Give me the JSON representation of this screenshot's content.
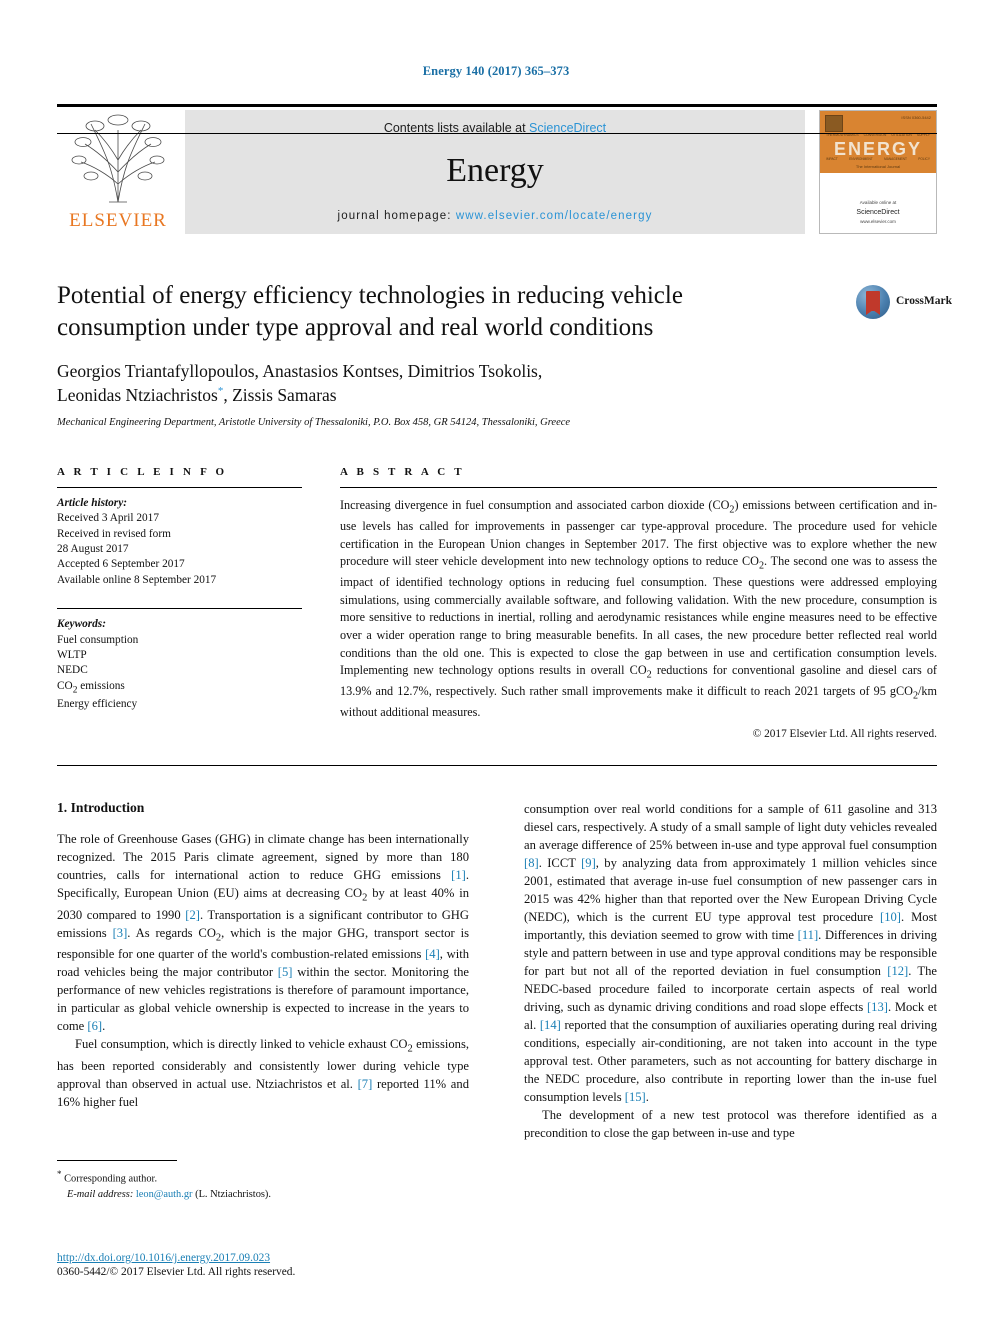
{
  "running_head": "Energy 140 (2017) 365–373",
  "masthead": {
    "contents_prefix": "Contents lists available at ",
    "contents_link": "ScienceDirect",
    "journal_name": "Energy",
    "homepage_prefix": "journal homepage: ",
    "homepage_url": "www.elsevier.com/locate/energy",
    "publisher_name": "ELSEVIER",
    "publisher_logo_alt": "elsevier-tree-logo"
  },
  "cover": {
    "title": "ENERGY",
    "subtitle": "The International Journal",
    "top_right": "ISSN 0360-5442",
    "topics_row1": [
      "THERMODYNAMICS",
      "CONVERSION",
      "UTILIZATION",
      "SUPPLY"
    ],
    "topics_row2": [
      "IMPACT",
      "ENVIRONMENT",
      "MANAGEMENT",
      "POLICY"
    ],
    "footer_small": "Available online at",
    "footer_big": "ScienceDirect",
    "footer_sub": "www.elsevier.com"
  },
  "crossmark": {
    "label": "CrossMark",
    "badge_alt": "crossmark-logo"
  },
  "article": {
    "title": "Potential of energy efficiency technologies in reducing vehicle consumption under type approval and real world conditions",
    "authors": "Georgios Triantafyllopoulos, Anastasios Kontses, Dimitrios Tsokolis, Leonidas Ntziachristos",
    "authors_line1": "Georgios Triantafyllopoulos, Anastasios Kontses, Dimitrios Tsokolis,",
    "authors_line2_a": "Leonidas Ntziachristos",
    "authors_corresponding_mark": "*",
    "authors_line2_b": ", Zissis Samaras",
    "affiliation": "Mechanical Engineering Department, Aristotle University of Thessaloniki, P.O. Box 458, GR 54124, Thessaloniki, Greece"
  },
  "article_info": {
    "heading": "A R T I C L E   I N F O",
    "history_label": "Article history:",
    "history": [
      "Received 3 April 2017",
      "Received in revised form",
      "28 August 2017",
      "Accepted 6 September 2017",
      "Available online 8 September 2017"
    ],
    "keywords_label": "Keywords:",
    "keywords": [
      "Fuel consumption",
      "WLTP",
      "NEDC",
      "CO2 emissions",
      "Energy efficiency"
    ]
  },
  "abstract": {
    "heading": "A B S T R A C T",
    "text": "Increasing divergence in fuel consumption and associated carbon dioxide (CO2) emissions between certification and in-use levels has called for improvements in passenger car type-approval procedure. The procedure used for vehicle certification in the European Union changes in September 2017. The first objective was to explore whether the new procedure will steer vehicle development into new technology options to reduce CO2. The second one was to assess the impact of identified technology options in reducing fuel consumption. These questions were addressed employing simulations, using commercially available software, and following validation. With the new procedure, consumption is more sensitive to reductions in inertial, rolling and aerodynamic resistances while engine measures need to be effective over a wider operation range to bring measurable benefits. In all cases, the new procedure better reflected real world conditions than the old one. This is expected to close the gap between in use and certification consumption levels. Implementing new technology options results in overall CO2 reductions for conventional gasoline and diesel cars of 13.9% and 12.7%, respectively. Such rather small improvements make it difficult to reach 2021 targets of 95 gCO2/km without additional measures.",
    "copyright": "© 2017 Elsevier Ltd. All rights reserved."
  },
  "body": {
    "section_number_title": "1.  Introduction",
    "left_paragraphs": [
      "The role of Greenhouse Gases (GHG) in climate change has been internationally recognized. The 2015 Paris climate agreement, signed by more than 180 countries, calls for international action to reduce GHG emissions [1]. Specifically, European Union (EU) aims at decreasing CO2 by at least 40% in 2030 compared to 1990 [2]. Transportation is a significant contributor to GHG emissions [3]. As regards CO2, which is the major GHG, transport sector is responsible for one quarter of the world's combustion-related emissions [4], with road vehicles being the major contributor [5] within the sector. Monitoring the performance of new vehicles registrations is therefore of paramount importance, in particular as global vehicle ownership is expected to increase in the years to come [6].",
      "Fuel consumption, which is directly linked to vehicle exhaust CO2 emissions, has been reported considerably and consistently lower during vehicle type approval than observed in actual use. Ntziachristos et al. [7] reported 11% and 16% higher fuel"
    ],
    "right_paragraphs": [
      "consumption over real world conditions for a sample of 611 gasoline and 313 diesel cars, respectively. A study of a small sample of light duty vehicles revealed an average difference of 25% between in-use and type approval fuel consumption [8]. ICCT [9], by analyzing data from approximately 1 million vehicles since 2001, estimated that average in-use fuel consumption of new passenger cars in 2015 was 42% higher than that reported over the New European Driving Cycle (NEDC), which is the current EU type approval test procedure [10]. Most importantly, this deviation seemed to grow with time [11]. Differences in driving style and pattern between in use and type approval conditions may be responsible for part but not all of the reported deviation in fuel consumption [12]. The NEDC-based procedure failed to incorporate certain aspects of real world driving, such as dynamic driving conditions and road slope effects [13]. Mock et al. [14] reported that the consumption of auxiliaries operating during real driving conditions, especially air-conditioning, are not taken into account in the type approval test. Other parameters, such as not accounting for battery discharge in the NEDC procedure, also contribute in reporting lower than the in-use fuel consumption levels [15].",
      "The development of a new test protocol was therefore identified as a precondition to close the gap between in-use and type"
    ]
  },
  "footnote": {
    "corresponding_mark": "*",
    "corresponding_label": "Corresponding author.",
    "email_label": "E-mail address:",
    "email": "leon@auth.gr",
    "email_owner": "(L. Ntziachristos)."
  },
  "footer": {
    "doi": "http://dx.doi.org/10.1016/j.energy.2017.09.023",
    "issn_line": "0360-5442/© 2017 Elsevier Ltd. All rights reserved."
  },
  "colors": {
    "link_blue": "#1a7fb5",
    "sciencedirect_blue": "#2a93d5",
    "elsevier_orange": "#e87722",
    "cover_orange": "#d98431"
  }
}
